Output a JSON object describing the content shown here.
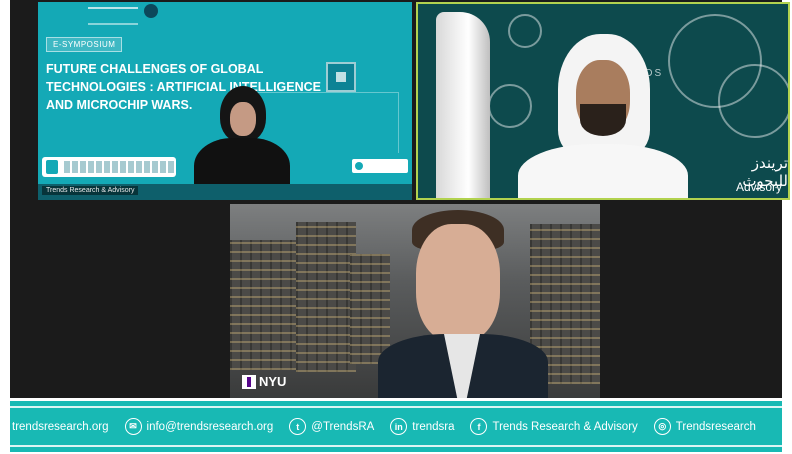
{
  "meeting": {
    "slide": {
      "badge": "E-SYMPOSIUM",
      "title": "FUTURE CHALLENGES OF GLOBAL TECHNOLOGIES : ARTIFICIAL INTELLIGENCE AND MICROCHIP WARS.",
      "email": "mail@trendsresearch.org",
      "footer_label": "Trends Research & Advisory"
    },
    "tile2": {
      "watermark": "TRENDS",
      "arabic": "تريندز للبحوث",
      "advisory": "Advisory"
    },
    "tile3": {
      "logo": "NYU"
    }
  },
  "footer": {
    "website": "trendsresearch.org",
    "email": "info@trendsresearch.org",
    "twitter": "@TrendsRA",
    "linkedin": "trendsra",
    "facebook": "Trends Research & Advisory",
    "instagram": "Trendsresearch",
    "icons": [
      "mail-icon",
      "twitter-icon",
      "linkedin-icon",
      "facebook-icon",
      "instagram-icon"
    ]
  },
  "colors": {
    "footer_bg": "#18b9b4",
    "slide_bg": "#14a9b6",
    "active_speaker_border": "#b2d24f"
  }
}
